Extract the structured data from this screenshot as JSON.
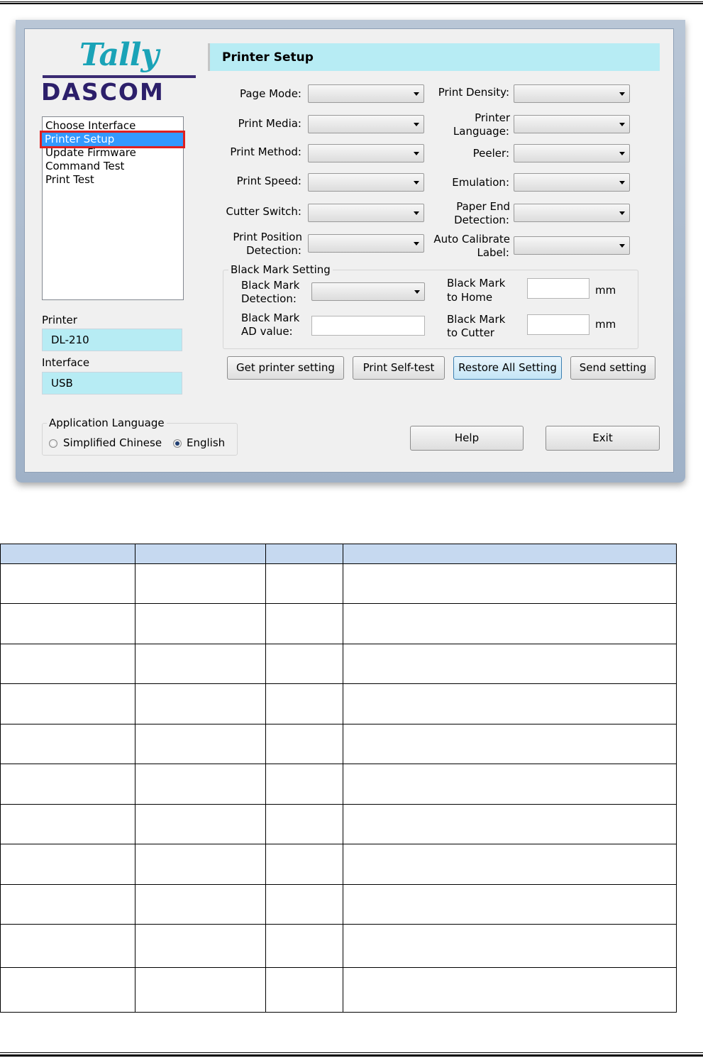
{
  "header": {
    "title": "Printer Setup"
  },
  "logo": {
    "tally": "Tally",
    "dascom": "DASCOM"
  },
  "sidebar": {
    "items": [
      {
        "label": "Choose Interface"
      },
      {
        "label": "Printer Setup"
      },
      {
        "label": "Update Firmware"
      },
      {
        "label": "Command Test"
      },
      {
        "label": "Print Test"
      }
    ],
    "printer_label": "Printer",
    "printer_value": "DL-210",
    "interface_label": "Interface",
    "interface_value": "USB"
  },
  "settings": {
    "page_mode": "Page Mode:",
    "print_media": "Print Media:",
    "print_method": "Print Method:",
    "print_speed": "Print Speed:",
    "cutter_switch": "Cutter Switch:",
    "print_position_1": "Print Position",
    "print_position_2": "Detection:",
    "print_density": "Print Density:",
    "printer_language_1": "Printer",
    "printer_language_2": "Language:",
    "peeler": "Peeler:",
    "emulation": "Emulation:",
    "paper_end_1": "Paper End",
    "paper_end_2": "Detection:",
    "auto_calibrate_1": "Auto Calibrate",
    "auto_calibrate_2": "Label:"
  },
  "black_mark": {
    "group_title": "Black Mark Setting",
    "detection_1": "Black Mark",
    "detection_2": "Detection:",
    "ad_1": "Black Mark",
    "ad_2": "AD value:",
    "home_1": "Black Mark",
    "home_2": "to Home",
    "cutter_1": "Black Mark",
    "cutter_2": "to Cutter",
    "unit": "mm"
  },
  "buttons": {
    "get_setting": "Get printer setting",
    "self_test": "Print Self-test",
    "restore": "Restore All Setting",
    "send": "Send setting",
    "help": "Help",
    "exit": "Exit"
  },
  "language": {
    "title": "Application Language",
    "options": [
      "Simplified Chinese",
      "English"
    ],
    "selected": "English"
  },
  "table": {
    "rows": 11,
    "columns": 4
  },
  "colors": {
    "accent_panel": "#b7ecf4",
    "selection": "#3399ff",
    "highlight_outline": "#e02020",
    "table_header": "#c6d9f0"
  }
}
